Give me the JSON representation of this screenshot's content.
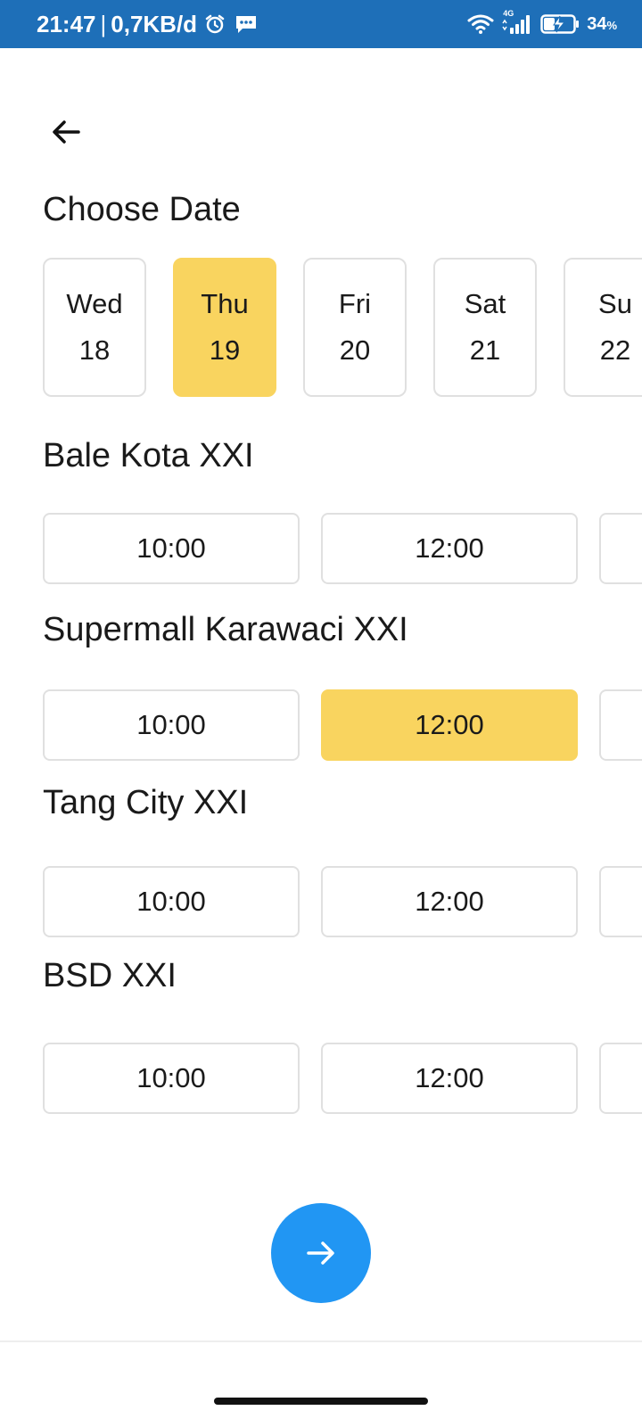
{
  "status_bar": {
    "time": "21:47",
    "separator": "|",
    "network_speed": "0,7KB/d",
    "network_type": "4G",
    "battery_percent": "34",
    "battery_unit": "%",
    "background_color": "#1e6fb8",
    "icons": [
      "alarm-icon",
      "message-icon",
      "wifi-icon",
      "signal-icon",
      "battery-charging-icon"
    ]
  },
  "header": {
    "back_icon": "arrow-left-icon"
  },
  "date_section": {
    "title": "Choose Date",
    "dates": [
      {
        "weekday": "Wed",
        "day": "18",
        "selected": false
      },
      {
        "weekday": "Thu",
        "day": "19",
        "selected": true
      },
      {
        "weekday": "Fri",
        "day": "20",
        "selected": false
      },
      {
        "weekday": "Sat",
        "day": "21",
        "selected": false
      },
      {
        "weekday": "Su",
        "day": "22",
        "selected": false
      }
    ]
  },
  "cinemas": [
    {
      "name": "Bale Kota XXI",
      "times": [
        "10:00",
        "12:00",
        ""
      ],
      "selected_index": -1
    },
    {
      "name": "Supermall Karawaci XXI",
      "times": [
        "10:00",
        "12:00",
        ""
      ],
      "selected_index": 1
    },
    {
      "name": "Tang City XXI",
      "times": [
        "10:00",
        "12:00",
        ""
      ],
      "selected_index": -1
    },
    {
      "name": "BSD XXI",
      "times": [
        "10:00",
        "12:00",
        ""
      ],
      "selected_index": -1
    }
  ],
  "next_button": {
    "icon": "arrow-right-icon",
    "color": "#2196f3"
  },
  "colors": {
    "accent_selected": "#f9d45f",
    "border": "#e0e0e0",
    "text": "#1a1a1a"
  }
}
